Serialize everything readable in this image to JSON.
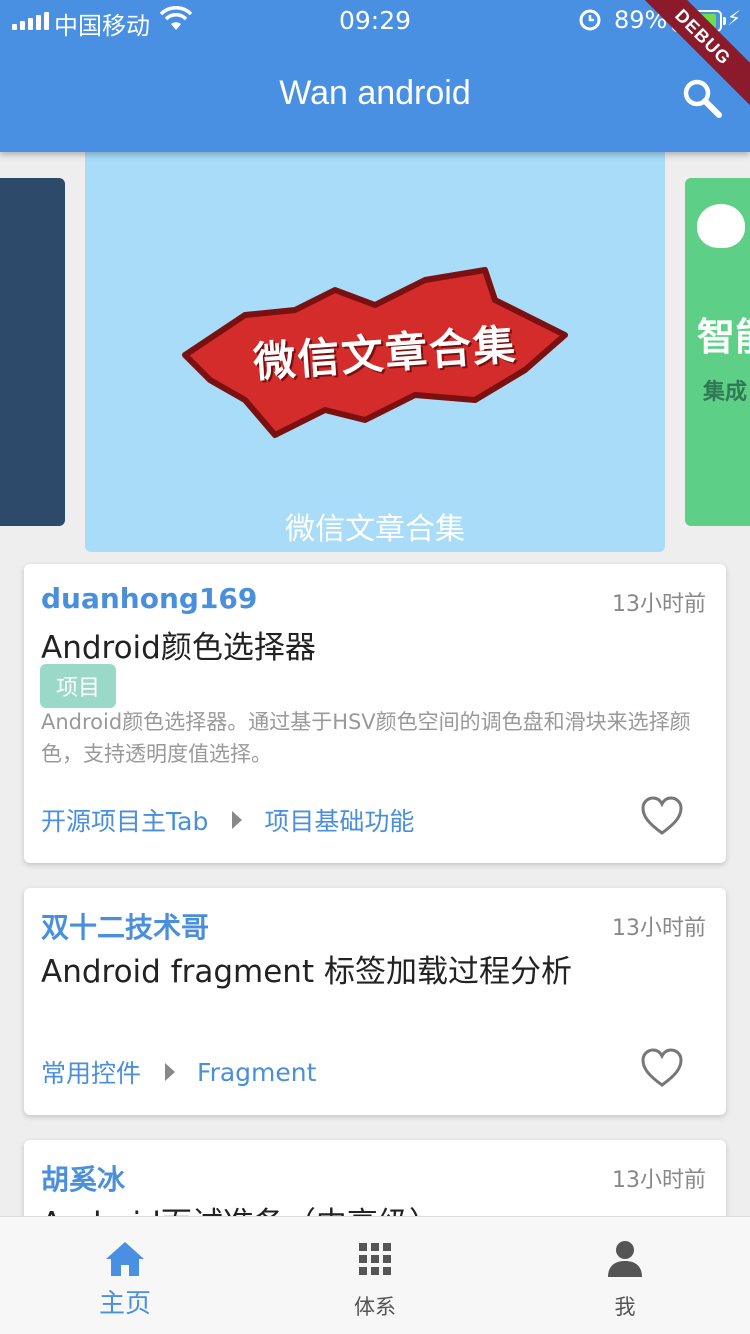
{
  "status_bar": {
    "carrier": "中国移动",
    "time": "09:29",
    "battery": "89%"
  },
  "app_bar": {
    "title": "Wan android",
    "debug_banner": "DEBUG"
  },
  "banner": {
    "art_text": "微信文章合集",
    "caption": "微信文章合集",
    "right_peek_big": "智能",
    "right_peek_small": "集成"
  },
  "articles": [
    {
      "author": "duanhong169",
      "time": "13小时前",
      "title": "Android颜色选择器",
      "tag": "项目",
      "desc": "Android颜色选择器。通过基于HSV颜色空间的调色盘和滑块来选择颜色，支持透明度值选择。",
      "chapter": "开源项目主Tab",
      "subchapter": "项目基础功能"
    },
    {
      "author": "双十二技术哥",
      "time": "13小时前",
      "title": "Android fragment 标签加载过程分析",
      "chapter": "常用控件",
      "subchapter": "Fragment"
    },
    {
      "author": "胡奚冰",
      "time": "13小时前",
      "title": "Android面试准备（中高级）"
    }
  ],
  "bottom_nav": {
    "items": [
      {
        "label": "主页",
        "icon": "home-icon",
        "active": true
      },
      {
        "label": "体系",
        "icon": "grid-icon",
        "active": false
      },
      {
        "label": "我",
        "icon": "person-icon",
        "active": false
      }
    ],
    "active_color": "#4a90e2",
    "inactive_color": "#555555"
  }
}
